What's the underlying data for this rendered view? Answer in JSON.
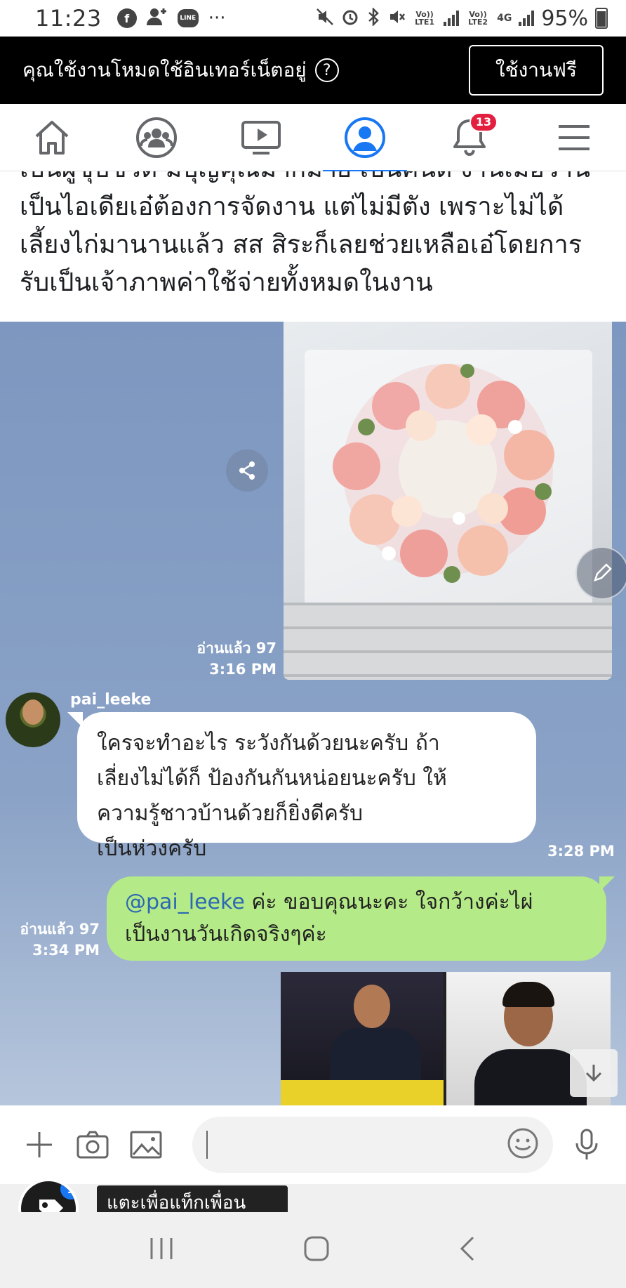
{
  "status_bar": {
    "time": "11:23",
    "network1": "Vo)) LTE1",
    "network2": "Vo)) LTE2",
    "net_type": "4G",
    "battery": "95%"
  },
  "banner": {
    "message": "คุณใช้งานโหมดใช้อินเทอร์เน็ตอยู่",
    "help": "?",
    "button": "ใช้งานฟรี"
  },
  "nav": {
    "notifications_badge": "13",
    "accent_color": "#1877f2"
  },
  "post": {
    "lines": [
      "เป็นผู้ชุบชีวิต มีบุญคุณมากมาย เป็นคนดี งานเมื่อวาน",
      "เป็นไอเดียเอ๋ต้องการจัดงาน แต่ไม่มีตัง เพราะไม่ได้",
      "เลี้ยงไก่มานานแล้ว สส สิระก็เลยช่วยเหลือเอ๋โดยการ",
      "รับเป็นเจ้าภาพค่าใช้จ่ายทั้งหมดในงาน"
    ]
  },
  "chat": {
    "msg1": {
      "read": "อ่านแล้ว 97",
      "time": "3:16 PM"
    },
    "msg2": {
      "sender": "pai_leeke",
      "lines": [
        "ใครจะทำอะไร  ระวังกันด้วยนะครับ  ถ้า",
        "เลี่ยงไม่ได้ก็ ป้องกันกันหน่อยนะครับ  ให้",
        "ความรู้ชาวบ้านด้วยก็ยิ่งดีครับ",
        "เป็นห่วงครับ"
      ],
      "time": "3:28 PM"
    },
    "msg3": {
      "mention": "@pai_leeke",
      "text1": " ค่ะ ขอบคุณนะคะ ใจกว้างค่ะไผ่",
      "text2": "เป็นงานวันเกิดจริงๆค่ะ",
      "read": "อ่านแล้ว 97",
      "time": "3:34 PM"
    }
  },
  "tooltip": {
    "text": "แตะเพื่อแท็กเพื่อน",
    "count": "1"
  }
}
